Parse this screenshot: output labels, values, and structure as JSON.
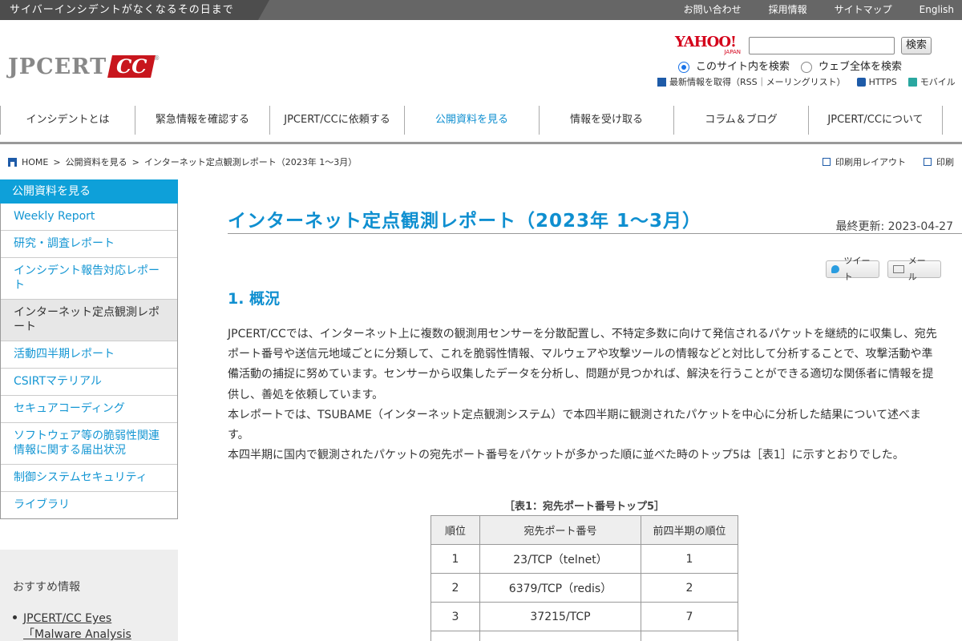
{
  "topbar": {
    "tagline": "サイバーインシデントがなくなるその日まで",
    "links": [
      "お問い合わせ",
      "採用情報",
      "サイトマップ",
      "English"
    ]
  },
  "logo": {
    "main": "JPCERT",
    "cc": "CC",
    "reg": "®"
  },
  "search": {
    "yahoo": "YAHOO!",
    "yahoo_sub": "JAPAN",
    "placeholder": "",
    "button": "検索",
    "scope_site": "このサイト内を検索",
    "scope_web": "ウェブ全体を検索"
  },
  "feeds": {
    "rss": "最新情報を取得（RSS｜メーリングリスト）",
    "https": "HTTPS",
    "mobile": "モバイル"
  },
  "gnav": [
    "インシデントとは",
    "緊急情報を確認する",
    "JPCERT/CCに依頼する",
    "公開資料を見る",
    "情報を受け取る",
    "コラム＆ブログ",
    "JPCERT/CCについて"
  ],
  "breadcrumb": {
    "home": "HOME",
    "sep": ">",
    "level1": "公開資料を見る",
    "level2": "インターネット定点観測レポート（2023年 1～3月）"
  },
  "print": {
    "layout": "印刷用レイアウト",
    "print": "印刷"
  },
  "sidebar": {
    "heading": "公開資料を見る",
    "items": [
      "Weekly Report",
      "研究・調査レポート",
      "インシデント報告対応レポート",
      "インターネット定点観測レポート",
      "活動四半期レポート",
      "CSIRTマテリアル",
      "セキュアコーディング",
      "ソフトウェア等の脆弱性関連情報に関する届出状況",
      "制御システムセキュリティ",
      "ライブラリ"
    ]
  },
  "recommend": {
    "title": "おすすめ情報",
    "item1": "JPCERT/CC Eyes",
    "item2": "「Malware Analysis"
  },
  "main": {
    "title": "インターネット定点観測レポート（2023年 1～3月）",
    "updated": "最終更新: 2023-04-27",
    "share_tweet": "ツイート",
    "share_mail": "メール",
    "section": "1. 概況",
    "p1": "JPCERT/CCでは、インターネット上に複数の観測用センサーを分散配置し、不特定多数に向けて発信されるパケットを継続的に収集し、宛先ポート番号や送信元地域ごとに分類して、これを脆弱性情報、マルウェアや攻撃ツールの情報などと対比して分析することで、攻撃活動や準備活動の捕捉に努めています。センサーから収集したデータを分析し、問題が見つかれば、解決を行うことができる適切な関係者に情報を提供し、善処を依頼しています。",
    "p2": "本レポートでは、TSUBAME（インターネット定点観測システム）で本四半期に観測されたパケットを中心に分析した結果について述べます。",
    "p3": "本四半期に国内で観測されたパケットの宛先ポート番号をパケットが多かった順に並べた時のトップ5は［表1］に示すとおりでした。"
  },
  "table": {
    "caption": "［表1：宛先ポート番号トップ5］",
    "headers": [
      "順位",
      "宛先ポート番号",
      "前四半期の順位"
    ],
    "rows": [
      [
        "1",
        "23/TCP（telnet）",
        "1"
      ],
      [
        "2",
        "6379/TCP（redis）",
        "2"
      ],
      [
        "3",
        "37215/TCP",
        "7"
      ],
      [
        "",
        "",
        ""
      ]
    ]
  }
}
